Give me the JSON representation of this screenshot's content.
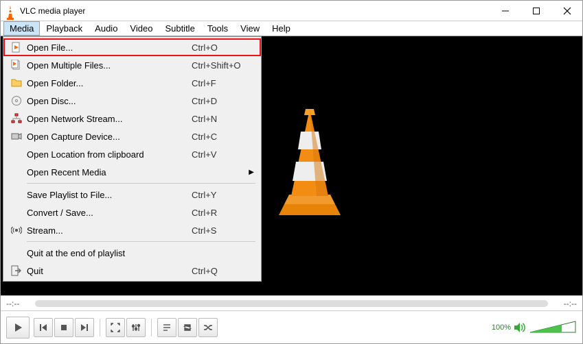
{
  "window": {
    "title": "VLC media player"
  },
  "menubar": {
    "media": "Media",
    "playback": "Playback",
    "audio": "Audio",
    "video": "Video",
    "subtitle": "Subtitle",
    "tools": "Tools",
    "view": "View",
    "help": "Help"
  },
  "media_menu": {
    "open_file": {
      "label": "Open File...",
      "shortcut": "Ctrl+O"
    },
    "open_multiple": {
      "label": "Open Multiple Files...",
      "shortcut": "Ctrl+Shift+O"
    },
    "open_folder": {
      "label": "Open Folder...",
      "shortcut": "Ctrl+F"
    },
    "open_disc": {
      "label": "Open Disc...",
      "shortcut": "Ctrl+D"
    },
    "open_network": {
      "label": "Open Network Stream...",
      "shortcut": "Ctrl+N"
    },
    "open_capture": {
      "label": "Open Capture Device...",
      "shortcut": "Ctrl+C"
    },
    "open_clipboard": {
      "label": "Open Location from clipboard",
      "shortcut": "Ctrl+V"
    },
    "open_recent": {
      "label": "Open Recent Media",
      "shortcut": ""
    },
    "save_playlist": {
      "label": "Save Playlist to File...",
      "shortcut": "Ctrl+Y"
    },
    "convert": {
      "label": "Convert / Save...",
      "shortcut": "Ctrl+R"
    },
    "stream": {
      "label": "Stream...",
      "shortcut": "Ctrl+S"
    },
    "quit_end": {
      "label": "Quit at the end of playlist",
      "shortcut": ""
    },
    "quit": {
      "label": "Quit",
      "shortcut": "Ctrl+Q"
    }
  },
  "seek": {
    "elapsed": "--:--",
    "remaining": "--:--"
  },
  "volume": {
    "percent": "100%"
  }
}
